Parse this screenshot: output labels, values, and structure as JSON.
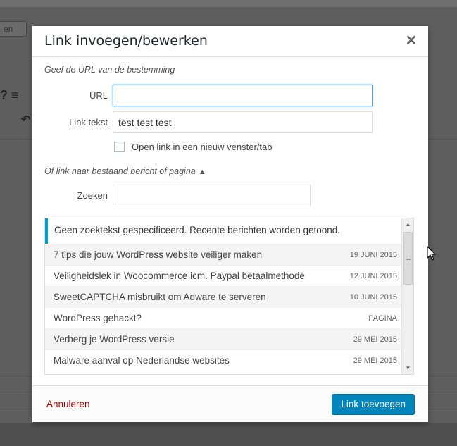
{
  "background": {
    "top_button_label": "en",
    "toolbar_glyphs": "? ≡"
  },
  "dialog": {
    "title": "Link invoegen/bewerken",
    "close_icon": "close-icon",
    "url_hint": "Geef de URL van de bestemming",
    "url_label": "URL",
    "url_value": "",
    "link_text_label": "Link tekst",
    "link_text_value": "test test test",
    "new_window_label": "Open link in een nieuw venster/tab",
    "new_window_checked": false,
    "existing_hint": "Of link naar bestaand bericht of pagina",
    "existing_toggle_icon": "triangle-up-icon",
    "search_label": "Zoeken",
    "search_value": "",
    "results_notice": "Geen zoektekst gespecificeerd. Recente berichten worden getoond.",
    "results": [
      {
        "title": "7 tips die jouw WordPress website veiliger maken",
        "date": "19 JUNI 2015"
      },
      {
        "title": "Veiligheidslek in Woocommerce icm. Paypal betaalmethode",
        "date": "12 JUNI 2015"
      },
      {
        "title": "SweetCAPTCHA misbruikt om Adware te serveren",
        "date": "10 JUNI 2015"
      },
      {
        "title": "WordPress gehackt?",
        "date": "PAGINA"
      },
      {
        "title": "Verberg je WordPress versie",
        "date": "29 MEI 2015"
      },
      {
        "title": "Malware aanval op Nederlandse websites",
        "date": "29 MEI 2015"
      }
    ],
    "cancel_label": "Annuleren",
    "submit_label": "Link toevoegen"
  },
  "colors": {
    "accent": "#0085ba",
    "notice_border": "#00a0d2",
    "cancel": "#aa0000"
  }
}
